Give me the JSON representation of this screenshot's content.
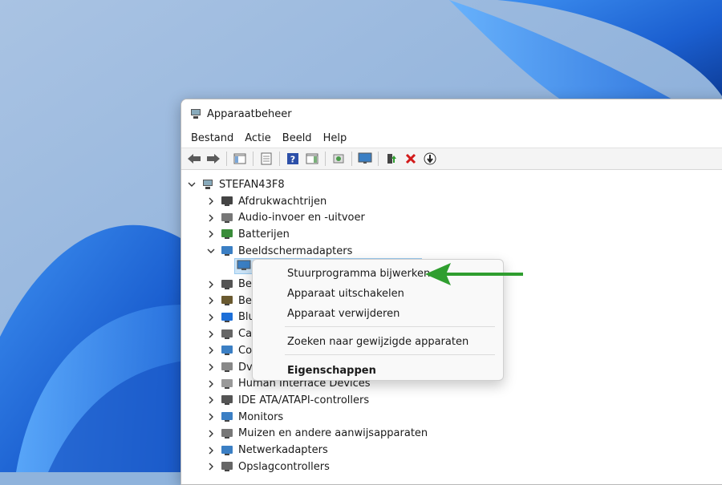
{
  "window": {
    "title": "Apparaatbeheer"
  },
  "menubar": {
    "items": [
      "Bestand",
      "Actie",
      "Beeld",
      "Help"
    ]
  },
  "toolbar": {
    "icons": [
      "back-icon",
      "forward-icon",
      "console-tree-icon",
      "properties-icon",
      "help-icon",
      "action-pane-icon",
      "scan-hardware-icon",
      "monitor-icon",
      "enable-device-icon",
      "uninstall-icon",
      "update-driver-icon"
    ]
  },
  "tree": {
    "root": "STEFAN43F8",
    "items": [
      "Afdrukwachtrijen",
      "Audio-invoer en -uitvoer",
      "Batterijen",
      "Beeldschermadapters",
      "Be",
      "Be",
      "Blu",
      "Ca",
      "Co",
      "Dv",
      "Human Interface Devices",
      "IDE ATA/ATAPI-controllers",
      "Monitors",
      "Muizen en andere aanwijsapparaten",
      "Netwerkadapters",
      "Opslagcontrollers"
    ]
  },
  "context_menu": {
    "update_driver": "Stuurprogramma bijwerken",
    "disable_device": "Apparaat uitschakelen",
    "uninstall_device": "Apparaat verwijderen",
    "scan_changes": "Zoeken naar gewijzigde apparaten",
    "properties": "Eigenschappen"
  },
  "colors": {
    "accent": "#2f9e2f",
    "selection": "#cce4f7",
    "wallpaper": "#8fb3dc"
  }
}
